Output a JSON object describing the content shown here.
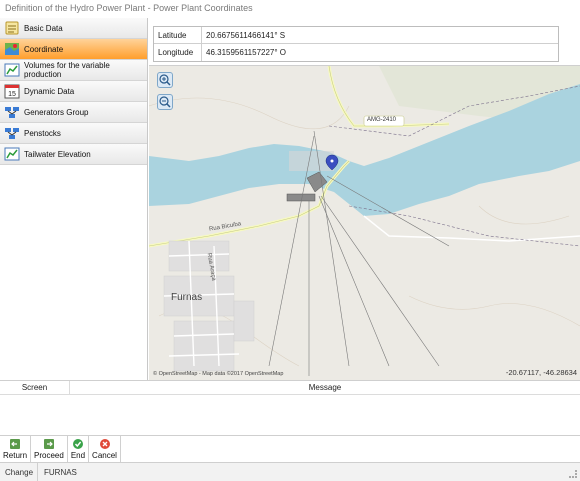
{
  "window": {
    "title": "Definition of the Hydro Power Plant  - Power Plant Coordinates"
  },
  "sidebar": {
    "items": [
      {
        "label": "Basic Data",
        "icon": "notes-icon",
        "active": false
      },
      {
        "label": "Coordinate",
        "icon": "map-icon",
        "active": true
      },
      {
        "label": "Volumes for the variable production",
        "icon": "chart-icon",
        "active": false
      },
      {
        "label": "Dynamic Data",
        "icon": "calendar-icon",
        "active": false
      },
      {
        "label": "Generators Group",
        "icon": "network-icon",
        "active": false
      },
      {
        "label": "Penstocks",
        "icon": "network-icon",
        "active": false
      },
      {
        "label": "Tailwater Elevation",
        "icon": "chart-icon",
        "active": false
      }
    ],
    "calendar_day": "15"
  },
  "coordinates": {
    "latitude_label": "Latitude",
    "latitude_value": "20.6675611466141° S",
    "longitude_label": "Longitude",
    "longitude_value": "46.3159561157227° O"
  },
  "map": {
    "road_label": "AMG-2410",
    "street_label": "Rua Bicuiba",
    "street_label_2": "Rua Araça",
    "town_label": "Furnas",
    "attribution": "© OpenStreetMap - Map data ©2017 OpenStreetMap",
    "cursor_coords": "-20.67117, -46.28634",
    "water_color": "#aad3df",
    "marker_color": "#3a4fc0"
  },
  "messages": {
    "col_screen": "Screen",
    "col_message": "Message"
  },
  "toolbar": {
    "return_label": "Return",
    "proceed_label": "Proceed",
    "end_label": "End",
    "cancel_label": "Cancel"
  },
  "status": {
    "mode": "Change",
    "plant": "FURNAS"
  }
}
